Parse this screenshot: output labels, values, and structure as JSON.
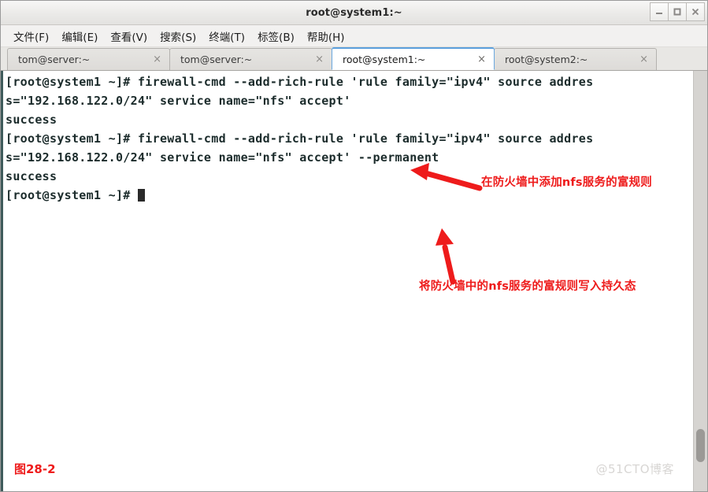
{
  "window": {
    "title": "root@system1:~",
    "controls": [
      {
        "name": "minimize",
        "glyph": "minimize-icon"
      },
      {
        "name": "maximize",
        "glyph": "maximize-icon"
      },
      {
        "name": "close",
        "glyph": "close-icon"
      }
    ]
  },
  "menubar": {
    "items": [
      {
        "label": "文件(F)"
      },
      {
        "label": "编辑(E)"
      },
      {
        "label": "查看(V)"
      },
      {
        "label": "搜索(S)"
      },
      {
        "label": "终端(T)"
      },
      {
        "label": "标签(B)"
      },
      {
        "label": "帮助(H)"
      }
    ]
  },
  "tabs": [
    {
      "label": "tom@server:~",
      "active": false,
      "close": "×"
    },
    {
      "label": "tom@server:~",
      "active": false,
      "close": "×"
    },
    {
      "label": "root@system1:~",
      "active": true,
      "close": "×"
    },
    {
      "label": "root@system2:~",
      "active": false,
      "close": "×"
    }
  ],
  "terminal": {
    "lines": [
      "[root@system1 ~]# firewall-cmd --add-rich-rule 'rule family=\"ipv4\" source addres",
      "s=\"192.168.122.0/24\" service name=\"nfs\" accept'",
      "success",
      "[root@system1 ~]# firewall-cmd --add-rich-rule 'rule family=\"ipv4\" source addres",
      "s=\"192.168.122.0/24\" service name=\"nfs\" accept' --permanent",
      "success",
      "[root@system1 ~]# "
    ],
    "prompt_last": "[root@system1 ~]# ",
    "cursor": "block-cursor"
  },
  "annotations": [
    {
      "id": "anno-add-rich-rule",
      "text": "在防火墙中添加nfs服务的富规则",
      "color": "#ee1b1b"
    },
    {
      "id": "anno-permanent",
      "text": "将防火墙中的nfs服务的富规则写入持久态",
      "color": "#ee1b1b"
    }
  ],
  "figure": {
    "label": "图28-2"
  },
  "watermark": {
    "text": "@51CTO博客"
  }
}
